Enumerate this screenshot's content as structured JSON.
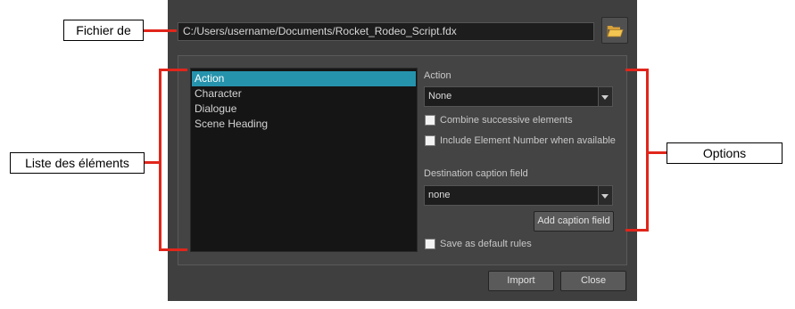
{
  "dialog": {
    "script_path": "C:/Users/username/Documents/Rocket_Rodeo_Script.fdx",
    "elements": [
      {
        "label": "Action",
        "selected": true
      },
      {
        "label": "Character",
        "selected": false
      },
      {
        "label": "Dialogue",
        "selected": false
      },
      {
        "label": "Scene Heading",
        "selected": false
      }
    ],
    "options": {
      "action_label": "Action",
      "action_value": "None",
      "combine_label": "Combine successive elements",
      "combine_checked": false,
      "include_number_label": "Include Element Number when available",
      "include_number_checked": false,
      "destination_label": "Destination caption field",
      "destination_value": "none",
      "add_caption_label": "Add caption field",
      "save_default_label": "Save as default rules",
      "save_default_checked": false
    },
    "buttons": {
      "import_label": "Import",
      "close_label": "Close"
    }
  },
  "callouts": {
    "file": "Fichier de",
    "elements": "Liste des éléments",
    "options": "Options"
  },
  "colors": {
    "dialog_bg": "#3f3f3f",
    "selection": "#2693ad",
    "callout_line": "#e1251b"
  },
  "icons": {
    "browse": "folder-open-icon",
    "dropdown": "chevron-down-icon"
  }
}
